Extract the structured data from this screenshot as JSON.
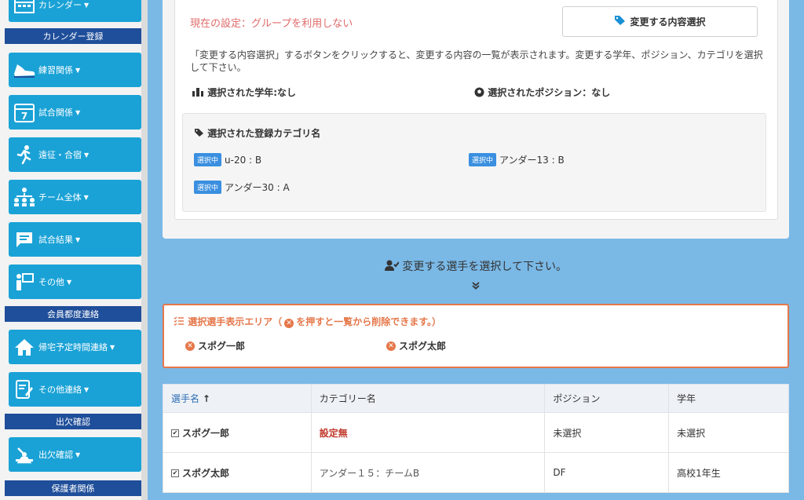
{
  "sidebar": {
    "calendar_btn": "カレンダー",
    "sec_calendar_reg": "カレンダー登録",
    "practice": "練習関係",
    "match": "試合関係",
    "expedition": "遠征・合宿",
    "team": "チーム全体",
    "results": "試合結果",
    "other": "その他",
    "sec_member_contact": "会員都度連絡",
    "return_time": "帰宅予定時間連絡",
    "other_contact": "その他連絡",
    "sec_attendance": "出欠確認",
    "attendance": "出欠確認",
    "sec_guardian": "保護者関係"
  },
  "settings": {
    "current": "現在の設定：グループを利用しない",
    "select_button": "変更する内容選択",
    "description": "「変更する内容選択」するボタンをクリックすると、変更する内容の一覧が表示されます。変更する学年、ポジション、カテゴリを選択して下さい。",
    "selected_grade": "選択された学年:なし",
    "selected_position": "選択されたポジション：なし",
    "category_title": "選択された登録カテゴリ名",
    "badge": "選択中",
    "categories": [
      "u-20 : B",
      "アンダー13 : B",
      "アンダー30 : A"
    ]
  },
  "instruction": "変更する選手を選択して下さい。",
  "selected_area": {
    "title": "選択選手表示エリア（",
    "title_suffix": "を押すと一覧から削除できます。）",
    "players": [
      "スポグ一郎",
      "スポグ太郎"
    ]
  },
  "table": {
    "headers": [
      "選手名",
      "カテゴリー名",
      "ポジション",
      "学年"
    ],
    "rows": [
      {
        "name": "スポグ一郎",
        "category": "設定無",
        "position": "未選択",
        "grade": "未選択"
      },
      {
        "name": "スポグ太郎",
        "category": "アンダー１５：チームB",
        "position": "DF",
        "grade": "高校1年生"
      }
    ]
  }
}
